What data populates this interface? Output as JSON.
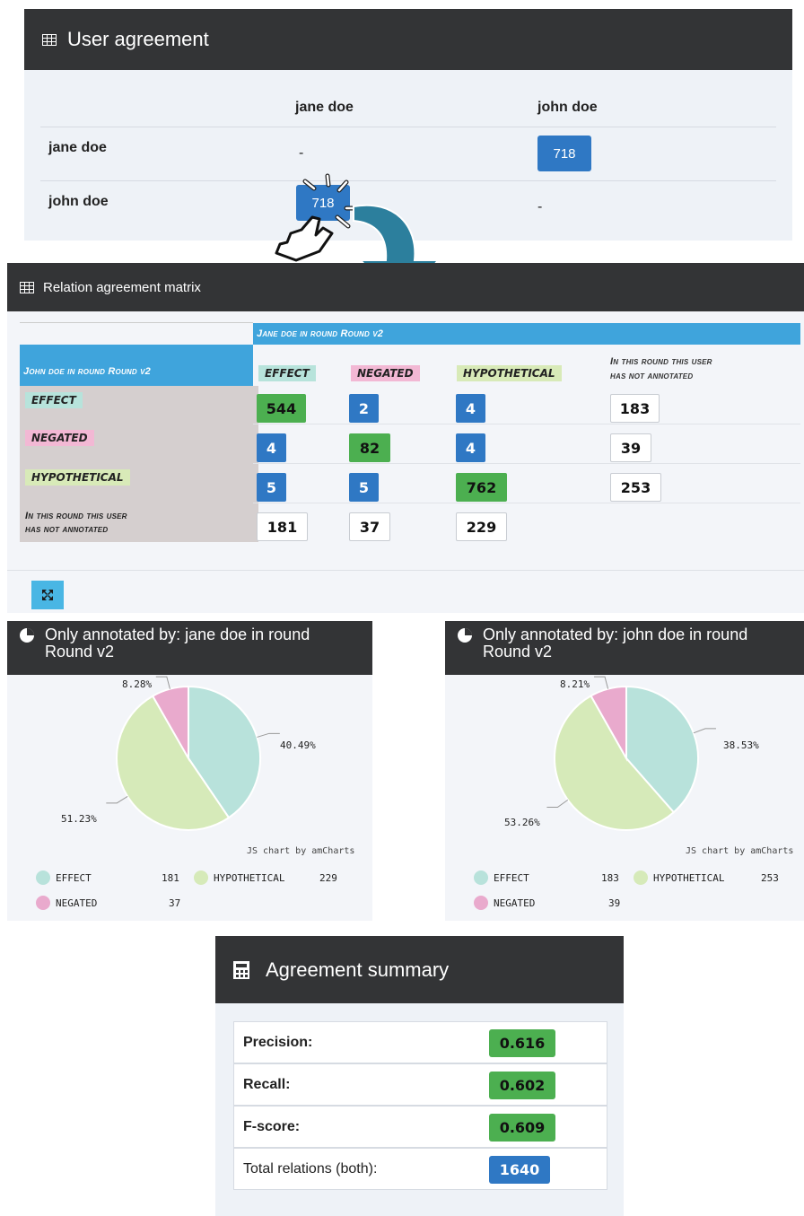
{
  "user_agreement": {
    "title": "User agreement",
    "col_headers": [
      "jane doe",
      "john doe"
    ],
    "rows": [
      {
        "label": "jane doe",
        "cells": [
          "-",
          "718"
        ]
      },
      {
        "label": "john doe",
        "cells": [
          "718",
          "-"
        ]
      }
    ]
  },
  "relation_matrix": {
    "title": "Relation agreement matrix",
    "col_group_header": "Jane doe in round Round v2",
    "row_group_header": "John doe in round Round v2",
    "col_headers": [
      "EFFECT",
      "NEGATED",
      "HYPOTHETICAL"
    ],
    "col_not_annotated": [
      "In this round this user",
      "has not annotated"
    ],
    "row_labels": [
      "EFFECT",
      "NEGATED",
      "HYPOTHETICAL"
    ],
    "row_not_annotated": [
      "In this round this user",
      "has not annotated"
    ],
    "values": [
      [
        "544",
        "2",
        "4",
        "183"
      ],
      [
        "4",
        "82",
        "4",
        "39"
      ],
      [
        "5",
        "5",
        "762",
        "253"
      ],
      [
        "181",
        "37",
        "229"
      ]
    ],
    "tag_colors": {
      "EFFECT": "#b7e3db",
      "NEGATED": "#f2b8d4",
      "HYPOTHETICAL": "#d8eab8"
    }
  },
  "pies": [
    {
      "title": "Only annotated by: jane doe in round Round v2",
      "credit": "JS chart by amCharts",
      "labels": [
        "40.49%",
        "51.23%",
        "8.28%"
      ],
      "legend": [
        {
          "name": "EFFECT",
          "value": "181"
        },
        {
          "name": "HYPOTHETICAL",
          "value": "229"
        },
        {
          "name": "NEGATED",
          "value": "37"
        }
      ]
    },
    {
      "title": "Only annotated by: john doe in round Round v2",
      "credit": "JS chart by amCharts",
      "labels": [
        "38.53%",
        "53.26%",
        "8.21%"
      ],
      "legend": [
        {
          "name": "EFFECT",
          "value": "183"
        },
        {
          "name": "HYPOTHETICAL",
          "value": "253"
        },
        {
          "name": "NEGATED",
          "value": "39"
        }
      ]
    }
  ],
  "chart_data": [
    {
      "type": "pie",
      "title": "Only annotated by: jane doe in round Round v2",
      "categories": [
        "EFFECT",
        "HYPOTHETICAL",
        "NEGATED"
      ],
      "values": [
        40.49,
        51.23,
        8.28
      ],
      "counts": [
        181,
        229,
        37
      ],
      "colors": [
        "#b8e2db",
        "#d6eab9",
        "#e9aacd"
      ],
      "legend": "bottom"
    },
    {
      "type": "pie",
      "title": "Only annotated by: john doe in round Round v2",
      "categories": [
        "EFFECT",
        "HYPOTHETICAL",
        "NEGATED"
      ],
      "values": [
        38.53,
        53.26,
        8.21
      ],
      "counts": [
        183,
        253,
        39
      ],
      "colors": [
        "#b8e2db",
        "#d6eab9",
        "#e9aacd"
      ],
      "legend": "bottom"
    }
  ],
  "summary": {
    "title": "Agreement summary",
    "rows": [
      {
        "label": "Precision:",
        "value": "0.616"
      },
      {
        "label": "Recall:",
        "value": "0.602"
      },
      {
        "label": "F-score:",
        "value": "0.609"
      },
      {
        "label": "Total relations (both):",
        "value": "1640"
      }
    ]
  }
}
